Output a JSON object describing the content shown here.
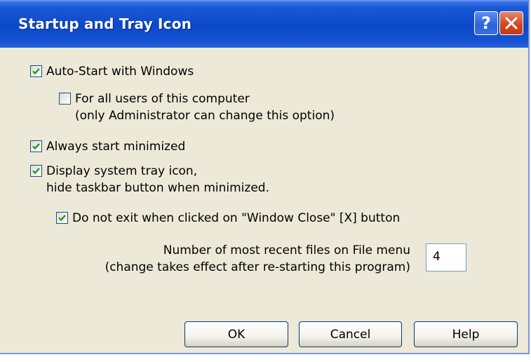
{
  "window": {
    "title": "Startup and Tray Icon",
    "help_glyph": "?",
    "close_icon": "close-icon"
  },
  "options": {
    "auto_start": {
      "label": "Auto-Start with Windows",
      "checked": true
    },
    "all_users": {
      "line1": "For all users of this computer",
      "line2": "(only Administrator can change this option)",
      "checked": false
    },
    "start_minimized": {
      "label": "Always start minimized",
      "checked": true
    },
    "tray_icon": {
      "line1": "Display system tray icon,",
      "line2": "hide taskbar button when minimized.",
      "checked": true
    },
    "no_exit": {
      "label": "Do not exit when clicked on \"Window Close\" [X] button",
      "checked": true
    }
  },
  "recent_files": {
    "line1": "Number of most recent files on File menu",
    "line2": "(change takes effect after re-starting this program)",
    "value": "4"
  },
  "buttons": {
    "ok": "OK",
    "cancel": "Cancel",
    "help": "Help"
  },
  "colors": {
    "titlebar": "#0c48c8",
    "dialog_bg": "#ece9d8",
    "check_green": "#21a121"
  }
}
